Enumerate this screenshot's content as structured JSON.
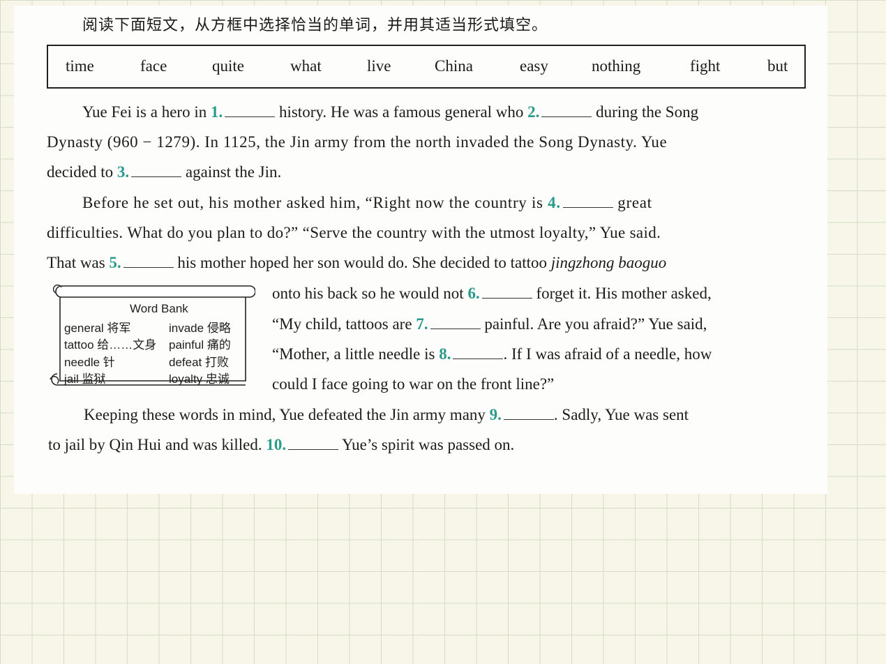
{
  "instruction": "阅读下面短文，从方框中选择恰当的单词，并用其适当形式填空。",
  "word_box": [
    "time",
    "face",
    "quite",
    "what",
    "live",
    "China",
    "easy",
    "nothing",
    "fight",
    "but"
  ],
  "passage": {
    "l1a": "Yue Fei is a hero in",
    "n1": "1.",
    "l1b": "history.  He was a famous general who",
    "n2": "2.",
    "l1c": "during the Song",
    "l2": "Dynasty (960 − 1279).  In 1125, the Jin army from the north invaded the Song Dynasty.  Yue",
    "l3a": "decided to",
    "n3": "3.",
    "l3b": "against the Jin.",
    "l4a": "Before he set out, his mother asked him, “Right now the country is",
    "n4": "4.",
    "l4b": "great",
    "l5": "difficulties.  What do you plan to do?” “Serve the country with the utmost loyalty,” Yue said.",
    "l6a": "That was",
    "n5": "5.",
    "l6b": "his mother hoped her son would do.  She decided to tattoo",
    "l6c": "jingzhong baoguo",
    "l7a": "onto his back so he would not",
    "n6": "6.",
    "l7b": "forget it.  His mother asked,",
    "l8a": "“My child, tattoos are",
    "n7": "7.",
    "l8b": "painful.  Are you afraid?” Yue said,",
    "l9a": "“Mother, a little needle is",
    "n8": "8.",
    "l9b": ".  If I was afraid of a needle, how",
    "l10": "could I face going to war on the front line?”",
    "l11a": "Keeping these words in mind, Yue defeated the Jin army many",
    "n9": "9.",
    "l11b": ".  Sadly, Yue was sent",
    "l12a": "to jail by Qin Hui and was killed.",
    "n10": "10.",
    "l12b": "Yue’s spirit was passed on."
  },
  "word_bank": {
    "title": "Word Bank",
    "items": [
      {
        "en": "general 将军",
        "col": 0
      },
      {
        "en": "invade 侵略",
        "col": 1
      },
      {
        "en": "tattoo 给……文身",
        "col": 0
      },
      {
        "en": "painful 痛的",
        "col": 1
      },
      {
        "en": "needle 针",
        "col": 0
      },
      {
        "en": "defeat 打败",
        "col": 1
      },
      {
        "en": "jail 监狱",
        "col": 0
      },
      {
        "en": "loyalty 忠诚",
        "col": 1
      }
    ]
  }
}
